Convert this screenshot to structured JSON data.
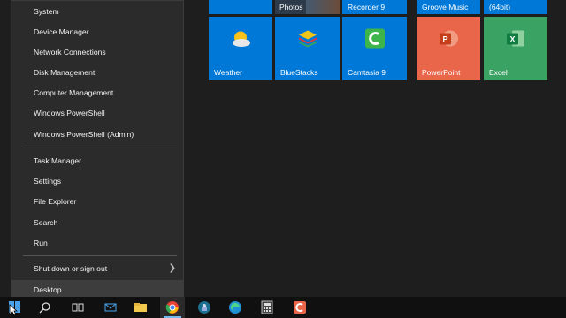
{
  "context_menu": {
    "items": [
      {
        "label": "System"
      },
      {
        "label": "Device Manager"
      },
      {
        "label": "Network Connections"
      },
      {
        "label": "Disk Management"
      },
      {
        "label": "Computer Management"
      },
      {
        "label": "Windows PowerShell"
      },
      {
        "label": "Windows PowerShell (Admin)"
      },
      {
        "label": "Task Manager"
      },
      {
        "label": "Settings"
      },
      {
        "label": "File Explorer"
      },
      {
        "label": "Search"
      },
      {
        "label": "Run"
      },
      {
        "label": "Shut down or sign out"
      },
      {
        "label": "Desktop"
      }
    ]
  },
  "tiles": {
    "top_row": [
      {
        "label": "Photos"
      },
      {
        "label": "Recorder 9"
      },
      {
        "label": "Groove Music"
      },
      {
        "label": "(64bit)"
      }
    ],
    "main_row": [
      {
        "label": "Weather",
        "color": "#0078d7"
      },
      {
        "label": "BlueStacks",
        "color": "#0078d7"
      },
      {
        "label": "Camtasia 9",
        "color": "#0078d7"
      },
      {
        "label": "PowerPoint",
        "color": "#e9664a"
      },
      {
        "label": "Excel",
        "color": "#3aa364"
      }
    ]
  },
  "colors": {
    "accent": "#0078d7",
    "menu_bg": "#2b2b2b",
    "taskbar_bg": "#101010"
  }
}
